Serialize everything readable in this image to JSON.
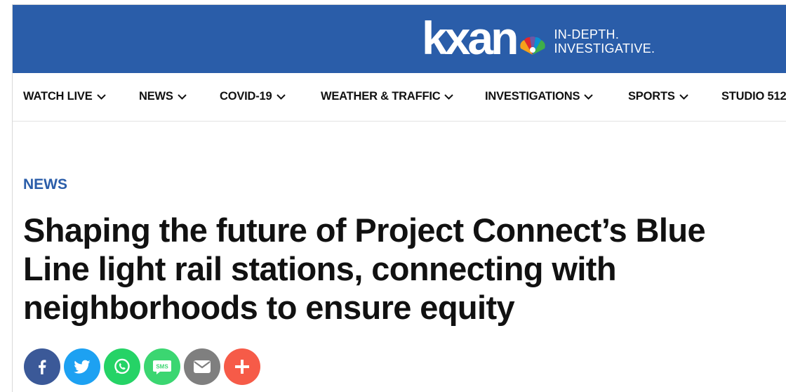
{
  "brand": {
    "logo_text": "kxan",
    "tagline_line1": "IN-DEPTH.",
    "tagline_line2": "INVESTIGATIVE.",
    "header_color": "#2a5da9"
  },
  "nav": {
    "items": [
      {
        "label": "WATCH LIVE",
        "icon": "chevron-down-icon"
      },
      {
        "label": "NEWS",
        "icon": "chevron-down-icon"
      },
      {
        "label": "COVID-19",
        "icon": "chevron-down-icon"
      },
      {
        "label": "WEATHER & TRAFFIC",
        "icon": "chevron-down-icon"
      },
      {
        "label": "INVESTIGATIONS",
        "icon": "chevron-down-icon"
      },
      {
        "label": "SPORTS",
        "icon": "chevron-down-icon"
      },
      {
        "label": "STUDIO 512",
        "icon": "chevron-down-icon"
      }
    ]
  },
  "article": {
    "category": "NEWS",
    "headline": "Shaping the future of Project Connect’s Blue Line light rail stations, connecting with neighborhoods to ensure equity"
  },
  "share": {
    "buttons": [
      {
        "name": "facebook",
        "icon": "facebook-icon",
        "color": "#3b5998"
      },
      {
        "name": "twitter",
        "icon": "twitter-icon",
        "color": "#1da1f2"
      },
      {
        "name": "whatsapp",
        "icon": "whatsapp-icon",
        "color": "#25d366"
      },
      {
        "name": "sms",
        "icon": "sms-icon",
        "color": "#3bd671",
        "label": "SMS"
      },
      {
        "name": "email",
        "icon": "envelope-icon",
        "color": "#7f7f7f"
      },
      {
        "name": "more",
        "icon": "plus-icon",
        "color": "#f65b48"
      }
    ]
  }
}
